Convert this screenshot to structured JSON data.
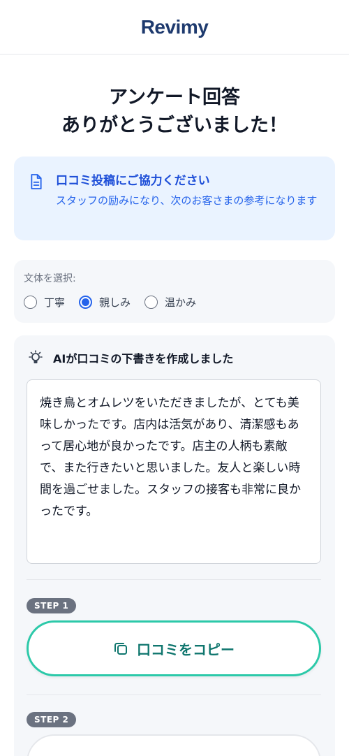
{
  "header": {
    "logo": "Revimy"
  },
  "title": {
    "line1": "アンケート回答",
    "line2": "ありがとうございました！"
  },
  "notice": {
    "icon": "document-icon",
    "title": "口コミ投稿にご協力ください",
    "text": "スタッフの励みになり、次のお客さまの参考になります",
    "colors": {
      "background": "#eaf3ff",
      "accent": "#1d4ed8"
    }
  },
  "style_select": {
    "label": "文体を選択:",
    "options": [
      {
        "label": "丁寧",
        "selected": false
      },
      {
        "label": "親しみ",
        "selected": true
      },
      {
        "label": "温かみ",
        "selected": false
      }
    ]
  },
  "ai": {
    "icon": "lightbulb-icon",
    "heading": "AIが口コミの下書きを作成しました",
    "draft": "焼き鳥とオムレツをいただきましたが、とても美味しかったです。店内は活気があり、清潔感もあって居心地が良かったです。店主の人柄も素敵で、また行きたいと思いました。友人と楽しい時間を過ごせました。スタッフの接客も非常に良かったです。"
  },
  "step1": {
    "badge": "STEP 1",
    "button_label": "口コミをコピー",
    "icon": "copy-icon",
    "accent": "#2cc9a9"
  },
  "step2": {
    "badge": "STEP 2"
  }
}
